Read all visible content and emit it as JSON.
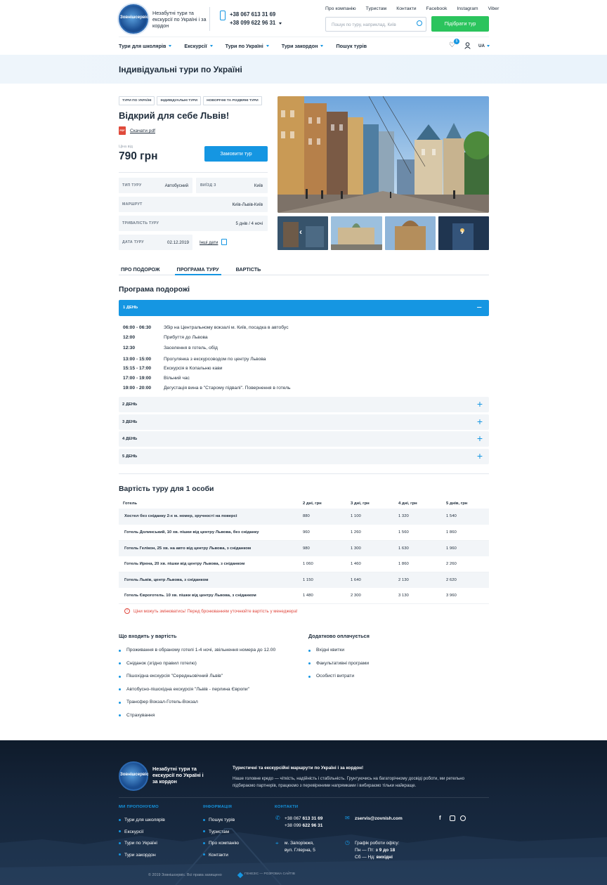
{
  "header": {
    "logo_text": "Зовнішсервіс",
    "tagline": "Незабутні тури та екскурсії по Україні і за кордон",
    "phones": [
      "+38 067 613 31 69",
      "+38 099 622 96 31"
    ],
    "top_links": [
      "Про компанію",
      "Туристам",
      "Контакти",
      "Facebook",
      "Instagram",
      "Viber"
    ],
    "search_placeholder": "Пошук по туру, наприклад, Київ",
    "cta": "Підібрати тур",
    "nav": [
      "Тури для школярів",
      "Екскурсії",
      "Тури по Україні",
      "Тури закордон",
      "Пошук турів"
    ],
    "wishlist_count": "5",
    "lang": "UA"
  },
  "page": {
    "band_title": "Індивідуальні тури по Україні",
    "tags": [
      "Тури по Україні",
      "Індивідуальні тури",
      "Новорічні та різдвяні тури"
    ],
    "tour_title": "Відкрий для себе Львів!",
    "pdf_icon": "PDF",
    "pdf_link": "Скачати pdf",
    "price_label": "Ціна від",
    "price": "790 грн",
    "order_button": "Замовити тур",
    "info": {
      "type_label": "Тип туру",
      "type_value": "Автобусний",
      "dep_label": "Виїзд з",
      "dep_value": "Київ",
      "route_label": "Маршрут",
      "route_value": "Київ-Львів-Київ",
      "dur_label": "Тривалість туру",
      "dur_value": "5 днів / 4 ночі",
      "date_label": "Дата туру",
      "date_value": "02.12.2019",
      "other_dates": "Інші дати"
    }
  },
  "tabs": [
    "Про подорож",
    "Програма туру",
    "Вартість"
  ],
  "program": {
    "title": "Програма подорожі",
    "day1": "1 день",
    "schedule": [
      {
        "time": "06:00 - 06:30",
        "text": "Збір на Центральному вокзалі м. Київ, посадка в автобус"
      },
      {
        "time": "12:00",
        "text": "Прибуття до Львова"
      },
      {
        "time": "12:30",
        "text": "Заселення в готель, обід"
      },
      {
        "time": "13:00 - 15:00",
        "text": "Прогулянка з екскурсоводом по центру Львова"
      },
      {
        "time": "15:15 - 17:00",
        "text": "Екскурсія в Копальню кави"
      },
      {
        "time": "17:00 - 19:00",
        "text": "Вільний час"
      },
      {
        "time": "19:00 - 20:00",
        "text": "Дегустація вина в \"Старому підвалі\". Повернення в готель"
      }
    ],
    "days": [
      "2 день",
      "3 день",
      "4 день",
      "5 день"
    ]
  },
  "prices": {
    "title": "Вартість туру для 1 особи",
    "headers": [
      "Готель",
      "2 дні, грн",
      "3 дні, грн",
      "4 дні, грн",
      "5 днів, грн"
    ],
    "rows": [
      [
        "Хостел без сніданку 2-х м. номер, зручності на поверсі",
        "880",
        "1 100",
        "1 320",
        "1 540"
      ],
      [
        "Готель Долинський, 10 хв. пішки від центру Львова, без сніданку",
        "960",
        "1 260",
        "1 560",
        "1 860"
      ],
      [
        "Готель Гелікон, 25 хв. на авто від центру Львова, з сніданком",
        "980",
        "1 300",
        "1 630",
        "1 960"
      ],
      [
        "Готель Ирена, 20 хв. пішки від центру Львова, з сніданком",
        "1 060",
        "1 460",
        "1 860",
        "2 260"
      ],
      [
        "Готель Львів, центр Львова, з сніданком",
        "1 150",
        "1 640",
        "2 130",
        "2 620"
      ],
      [
        "Готель Єврoготель. 10 хв. пішки від центру Львова, з сніданком",
        "1 480",
        "2 300",
        "3 130",
        "3 960"
      ]
    ],
    "warning": "Ціни можуть змінюватись! Перед бронюванням уточнюйте вартість у менеджера!"
  },
  "included": {
    "title": "Що входить у вартість",
    "items": [
      "Проживання в обраному готелі 1-4 ночі, звільнення номера до 12.00",
      "Сніданок (згідно правил готелю)",
      "Пішохідна екскурсія \"Середньовічний Львів\"",
      "Автобусно-пішохідна екскурсія \"Львів - перлина Європи\"",
      "Трансфер Вокзал-Готель-Вокзал",
      "Страхування"
    ]
  },
  "extra": {
    "title": "Додатково оплачується",
    "items": [
      "Вхідні квитки",
      "Факультативні програми",
      "Особисті витрати"
    ]
  },
  "footer": {
    "tagline": "Незабутні тури та екскурсії по Україні і за кордон",
    "heading": "Туристичні та екскурсійні маршрути по Україні і за кордон!",
    "text": "Наше головне кредо — чіткість, надійність і стабільність. Грунтуючись на багаторічному досвіді роботи, ми ретельно підбираємо партнерів, працюємо з перевіреними напрямками і вибираємо тільки найкраще.",
    "col1_title": "Ми пропонуємо",
    "col1": [
      "Тури для школярів",
      "Екскурсії",
      "Тури по Україні",
      "Тури закордон"
    ],
    "col2_title": "Інформація",
    "col2": [
      "Пошук турів",
      "Туристам",
      "Про компанію",
      "Контакти"
    ],
    "col3_title": "Контакти",
    "phone1_prefix": "+38 067 ",
    "phone1_bold": "613 31 69",
    "phone2_prefix": "+38 099 ",
    "phone2_bold": "622 96 31",
    "email": "zservis@zovnish.com",
    "address1": "м. Запоріжжя,",
    "address2": "вул. Гліерна, 5",
    "hours_title": "Графік роботи офісу:",
    "hours1_prefix": "Пн — Пт: ",
    "hours1_bold": "з 9 до 18",
    "hours2_prefix": "Сб — Нд: ",
    "hours2_bold": "вихідні",
    "copyright": "© 2019 Зовнішсервіс. Всі права захищено",
    "developer": "ГЕНЕЗІС — РОЗРОБКА САЙТІВ"
  }
}
